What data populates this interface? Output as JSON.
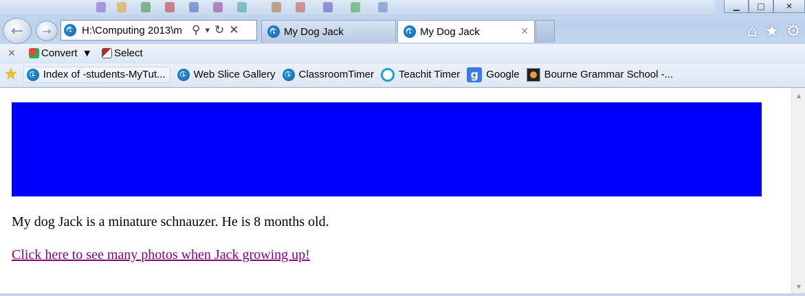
{
  "window": {
    "minimize_glyph": "▁",
    "maximize_glyph": "□",
    "close_glyph": "✕"
  },
  "navigation": {
    "back_glyph": "←",
    "forward_glyph": "→",
    "address": "H:\\Computing 2013\\m",
    "search_glyph": "⚲",
    "dropdown_glyph": "▾",
    "refresh_glyph": "↻",
    "stop_glyph": "✕"
  },
  "tabs": [
    {
      "title": "My Dog Jack",
      "active": false
    },
    {
      "title": "My Dog Jack",
      "active": true,
      "close_glyph": "✕"
    }
  ],
  "toolbar_icons": {
    "home_glyph": "⌂",
    "favorites_glyph": "★",
    "tools_glyph": "⚙"
  },
  "command_bar": {
    "close_glyph": "✕",
    "convert_label": "Convert",
    "dropdown_glyph": "▼",
    "select_label": "Select"
  },
  "favorites_bar": {
    "star_glyph": "★",
    "items": [
      {
        "label": "Index of -students-MyTut...",
        "icon": "ie-page-icon"
      },
      {
        "label": "Web Slice Gallery",
        "icon": "ie-page-icon"
      },
      {
        "label": "ClassroomTimer",
        "icon": "ie-page-icon"
      },
      {
        "label": "Teachit Timer",
        "icon": "teachit-icon"
      },
      {
        "label": "Google",
        "icon": "google-icon",
        "glyph": "g"
      },
      {
        "label": "Bourne Grammar School -...",
        "icon": "bourne-icon"
      }
    ]
  },
  "page": {
    "banner_color": "#0000ff",
    "paragraph": "My dog Jack is a minature schnauzer. He is 8 months old.",
    "link_text": "Click here to see many photos when Jack growing up!",
    "link_color": "#800080"
  },
  "scrollbar": {
    "up_glyph": "▲",
    "down_glyph": "▼"
  }
}
